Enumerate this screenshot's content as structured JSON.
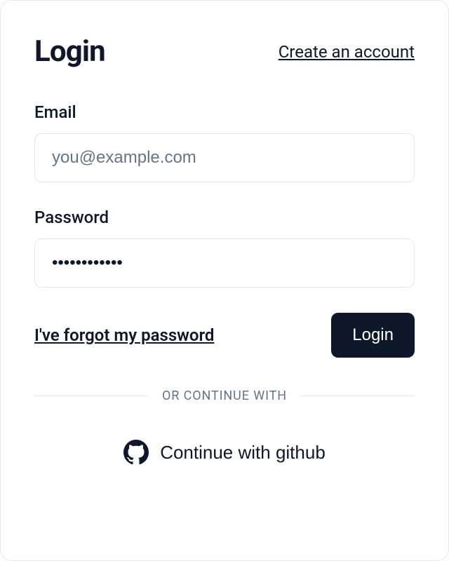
{
  "header": {
    "title": "Login",
    "create_account_label": "Create an account"
  },
  "form": {
    "email": {
      "label": "Email",
      "placeholder": "you@example.com",
      "value": ""
    },
    "password": {
      "label": "Password",
      "placeholder": "",
      "value": ""
    },
    "forgot_label": "I've forgot my password",
    "login_button_label": "Login"
  },
  "divider": {
    "text": "OR CONTINUE WITH"
  },
  "oauth": {
    "github_label": "Continue with github"
  },
  "icons": {
    "github": "github-icon"
  },
  "colors": {
    "primary": "#0f172a",
    "border": "#e5e7eb",
    "muted": "#64748b"
  }
}
